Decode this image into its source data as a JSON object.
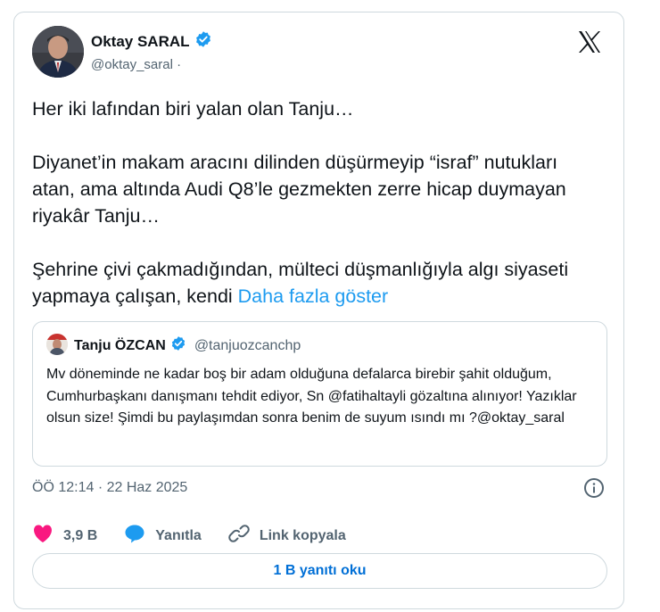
{
  "author": {
    "name": "Oktay SARAL",
    "handle": "@oktay_saral ·"
  },
  "tweet_text": "Her iki lafından biri yalan olan Tanju…\n\nDiyanet’in makam aracını dilinden düşürmeyip “israf” nutukları atan, ama altında Audi Q8’le gezmekten zerre hicap duymayan riyakâr Tanju…\n\nŞehrine çivi çakmadığından, mülteci düşmanlığıyla algı siyaseti yapmaya çalışan, kendi ",
  "show_more": "Daha fazla göster",
  "quote": {
    "name": "Tanju ÖZCAN",
    "handle": "@tanjuozcanchp",
    "text": "Mv döneminde ne kadar boş bir adam olduğuna defalarca birebir şahit olduğum, Cumhurbaşkanı danışmanı tehdit ediyor, Sn @fatihaltayli gözaltına alınıyor! Yazıklar olsun size! Şimdi bu paylaşımdan sonra benim de suyum ısındı mı ?@oktay_saral"
  },
  "timestamp": "ÖÖ 12:14 · 22 Haz 2025",
  "actions": {
    "likes": "3,9 B",
    "reply": "Yanıtla",
    "copy_link": "Link kopyala"
  },
  "read_replies": "1 B yanıtı oku",
  "colors": {
    "accent": "#1d9bf0",
    "verified": "#1d9bf0",
    "like": "#f91880",
    "border": "#cfd9de"
  },
  "icons": [
    "verified-badge-icon",
    "x-logo-icon",
    "heart-icon",
    "reply-bubble-icon",
    "link-icon",
    "info-icon"
  ]
}
